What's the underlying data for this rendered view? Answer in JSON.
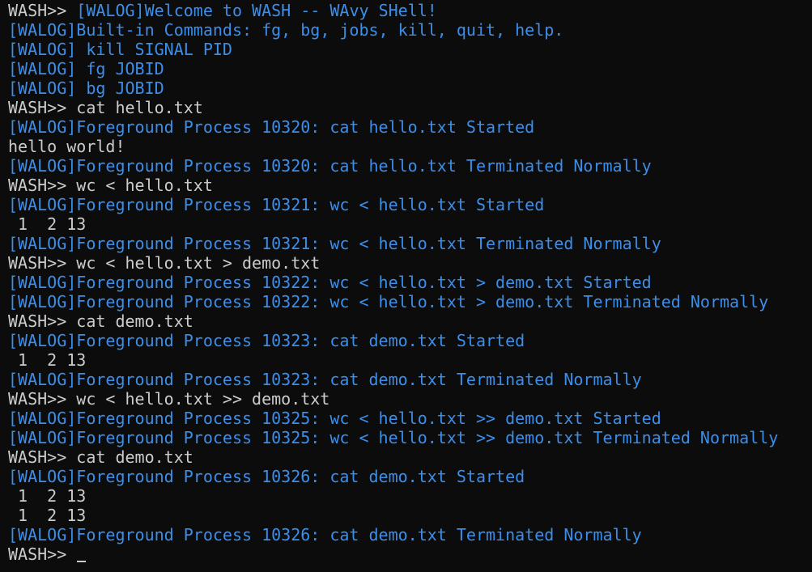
{
  "colors": {
    "background": "#0c0c0c",
    "text": "#cccccc",
    "log": "#3b8eea"
  },
  "prompt": "WASH>> ",
  "lines": [
    {
      "kind": "mixed",
      "prompt": "WASH>> ",
      "text": "[WALOG]Welcome to WASH -- WAvy SHell!"
    },
    {
      "kind": "log",
      "text": "[WALOG]Built-in Commands: fg, bg, jobs, kill, quit, help."
    },
    {
      "kind": "log",
      "text": "[WALOG] kill SIGNAL PID"
    },
    {
      "kind": "log",
      "text": "[WALOG] fg JOBID"
    },
    {
      "kind": "log",
      "text": "[WALOG] bg JOBID"
    },
    {
      "kind": "cmd",
      "prompt": "WASH>> ",
      "text": "cat hello.txt"
    },
    {
      "kind": "log",
      "text": "[WALOG]Foreground Process 10320: cat hello.txt Started"
    },
    {
      "kind": "out",
      "text": "hello world!"
    },
    {
      "kind": "log",
      "text": "[WALOG]Foreground Process 10320: cat hello.txt Terminated Normally"
    },
    {
      "kind": "cmd",
      "prompt": "WASH>> ",
      "text": "wc < hello.txt"
    },
    {
      "kind": "log",
      "text": "[WALOG]Foreground Process 10321: wc < hello.txt Started"
    },
    {
      "kind": "out",
      "text": " 1  2 13"
    },
    {
      "kind": "log",
      "text": "[WALOG]Foreground Process 10321: wc < hello.txt Terminated Normally"
    },
    {
      "kind": "cmd",
      "prompt": "WASH>> ",
      "text": "wc < hello.txt > demo.txt"
    },
    {
      "kind": "log",
      "text": "[WALOG]Foreground Process 10322: wc < hello.txt > demo.txt Started"
    },
    {
      "kind": "log",
      "text": "[WALOG]Foreground Process 10322: wc < hello.txt > demo.txt Terminated Normally"
    },
    {
      "kind": "cmd",
      "prompt": "WASH>> ",
      "text": "cat demo.txt"
    },
    {
      "kind": "log",
      "text": "[WALOG]Foreground Process 10323: cat demo.txt Started"
    },
    {
      "kind": "out",
      "text": " 1  2 13"
    },
    {
      "kind": "log",
      "text": "[WALOG]Foreground Process 10323: cat demo.txt Terminated Normally"
    },
    {
      "kind": "cmd",
      "prompt": "WASH>> ",
      "text": "wc < hello.txt >> demo.txt"
    },
    {
      "kind": "log",
      "text": "[WALOG]Foreground Process 10325: wc < hello.txt >> demo.txt Started"
    },
    {
      "kind": "log",
      "text": "[WALOG]Foreground Process 10325: wc < hello.txt >> demo.txt Terminated Normally"
    },
    {
      "kind": "cmd",
      "prompt": "WASH>> ",
      "text": "cat demo.txt"
    },
    {
      "kind": "log",
      "text": "[WALOG]Foreground Process 10326: cat demo.txt Started"
    },
    {
      "kind": "out",
      "text": " 1  2 13"
    },
    {
      "kind": "out",
      "text": " 1  2 13"
    },
    {
      "kind": "log",
      "text": "[WALOG]Foreground Process 10326: cat demo.txt Terminated Normally"
    },
    {
      "kind": "input",
      "prompt": "WASH>> ",
      "text": ""
    }
  ]
}
